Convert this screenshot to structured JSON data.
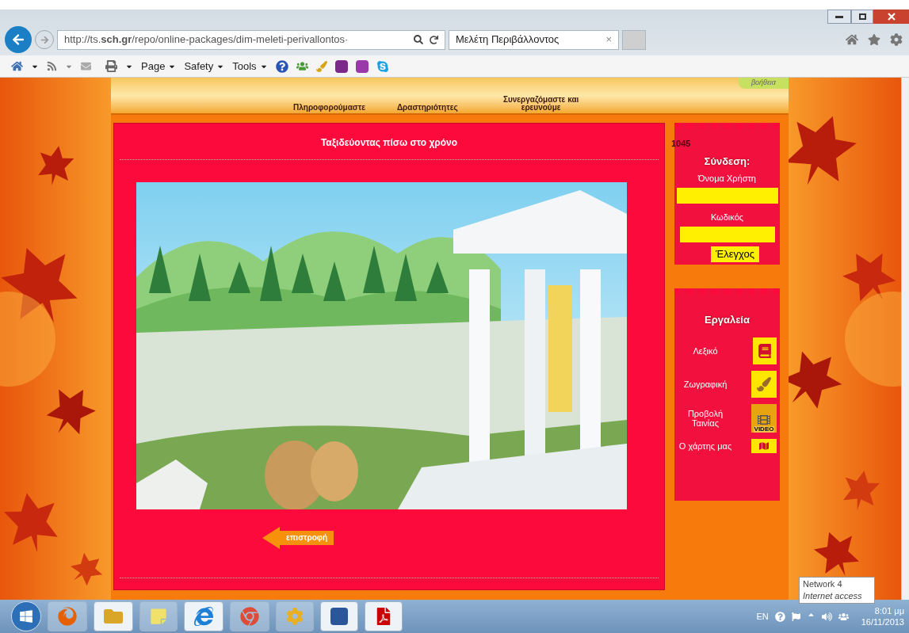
{
  "browser": {
    "address": "http://ts.**sch.gr**/repo/online-packages/dim-meleti-perivallontos·",
    "tab": {
      "title": "Μελέτη Περιβάλλοντος",
      "close": "×"
    },
    "command_bar": [
      "Page",
      "Safety",
      "Tools"
    ]
  },
  "header": {
    "nav": [
      "Πληροφορούμαστε",
      "Δραστηριότητες",
      "Συνεργαζόμαστε και ερευνούμε"
    ],
    "help": "βοήθεια"
  },
  "main": {
    "title": "Ταξιδεύοντας πίσω στο χρόνο",
    "back_button": "επιστροφή"
  },
  "login": {
    "counter": "1045",
    "heading": "Σύνδεση:",
    "username_label": "Όνομα Χρήστη",
    "password_label": "Κωδικός",
    "submit": "Έλεγχος"
  },
  "tools": {
    "heading": "Εργαλεία",
    "items": [
      {
        "kind": "dictionary",
        "label": "Λεξικό"
      },
      {
        "kind": "paint",
        "label": "Ζωγραφική"
      },
      {
        "kind": "video",
        "label": "Προβολή Ταινίας",
        "icon_text": "VIDEO"
      },
      {
        "kind": "map",
        "label": "Ο χάρτης μας"
      }
    ]
  },
  "taskbar": {
    "language": "EN",
    "time": "8:01 μμ",
    "date": "16/11/2013"
  },
  "tooltip": {
    "title": "Network 4",
    "subtitle": "Internet access"
  }
}
